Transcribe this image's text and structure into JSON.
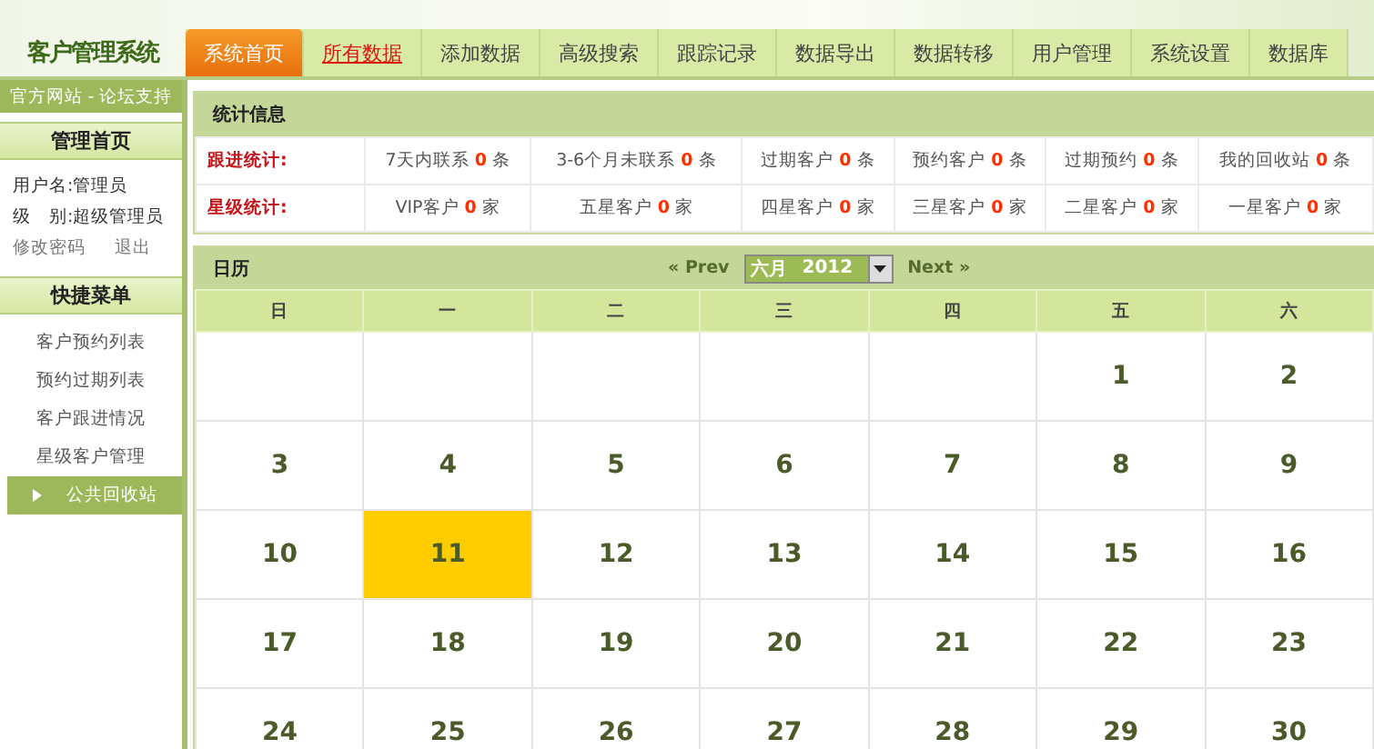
{
  "logo": "客户管理系统",
  "nav": [
    {
      "label": "系统首页",
      "selected": true,
      "kind": "normal"
    },
    {
      "label": "所有数据",
      "selected": false,
      "kind": "highlight"
    },
    {
      "label": "添加数据",
      "selected": false,
      "kind": "normal"
    },
    {
      "label": "高级搜索",
      "selected": false,
      "kind": "normal"
    },
    {
      "label": "跟踪记录",
      "selected": false,
      "kind": "normal"
    },
    {
      "label": "数据导出",
      "selected": false,
      "kind": "normal"
    },
    {
      "label": "数据转移",
      "selected": false,
      "kind": "normal"
    },
    {
      "label": "用户管理",
      "selected": false,
      "kind": "normal"
    },
    {
      "label": "系统设置",
      "selected": false,
      "kind": "normal"
    },
    {
      "label": "数据库",
      "selected": false,
      "kind": "normal"
    }
  ],
  "sidebar": {
    "top_links": "官方网站 - 论坛支持",
    "admin": {
      "title": "管理首页",
      "username": "用户名:管理员",
      "level": "级　别:超级管理员",
      "links": [
        "修改密码",
        "退出"
      ]
    },
    "menu": {
      "title": "快捷菜单",
      "items": [
        {
          "label": "客户预约列表",
          "selected": false
        },
        {
          "label": "预约过期列表",
          "selected": false
        },
        {
          "label": "客户跟进情况",
          "selected": false
        },
        {
          "label": "星级客户管理",
          "selected": false
        },
        {
          "label": "公共回收站",
          "selected": true
        }
      ]
    }
  },
  "stats": {
    "title": "统计信息",
    "rows": [
      {
        "label": "跟进统计:",
        "cells": [
          {
            "text": "7天内联系",
            "count": "0",
            "unit": "条"
          },
          {
            "text": "3-6个月未联系",
            "count": "0",
            "unit": "条"
          },
          {
            "text": "过期客户",
            "count": "0",
            "unit": "条"
          },
          {
            "text": "预约客户",
            "count": "0",
            "unit": "条"
          },
          {
            "text": "过期预约",
            "count": "0",
            "unit": "条"
          },
          {
            "text": "我的回收站",
            "count": "0",
            "unit": "条"
          }
        ]
      },
      {
        "label": "星级统计:",
        "cells": [
          {
            "text": "VIP客户",
            "count": "0",
            "unit": "家"
          },
          {
            "text": "五星客户",
            "count": "0",
            "unit": "家"
          },
          {
            "text": "四星客户",
            "count": "0",
            "unit": "家"
          },
          {
            "text": "三星客户",
            "count": "0",
            "unit": "家"
          },
          {
            "text": "二星客户",
            "count": "0",
            "unit": "家"
          },
          {
            "text": "一星客户",
            "count": "0",
            "unit": "家"
          }
        ]
      }
    ]
  },
  "calendar": {
    "title": "日历",
    "prev": "« Prev",
    "next": "Next »",
    "month": "六月",
    "year": "2012",
    "weekdays": [
      "日",
      "一",
      "二",
      "三",
      "四",
      "五",
      "六"
    ],
    "weeks": [
      [
        {
          "kind": "empty"
        },
        {
          "kind": "empty"
        },
        {
          "kind": "empty"
        },
        {
          "kind": "empty"
        },
        {
          "kind": "empty"
        },
        {
          "kind": "day",
          "day": "1",
          "selected": false
        },
        {
          "kind": "day",
          "day": "2",
          "selected": false
        }
      ],
      [
        {
          "kind": "day",
          "day": "3",
          "selected": false
        },
        {
          "kind": "day",
          "day": "4",
          "selected": false
        },
        {
          "kind": "day",
          "day": "5",
          "selected": false
        },
        {
          "kind": "day",
          "day": "6",
          "selected": false
        },
        {
          "kind": "day",
          "day": "7",
          "selected": false
        },
        {
          "kind": "day",
          "day": "8",
          "selected": false
        },
        {
          "kind": "day",
          "day": "9",
          "selected": false
        }
      ],
      [
        {
          "kind": "day",
          "day": "10",
          "selected": false
        },
        {
          "kind": "day",
          "day": "11",
          "selected": true
        },
        {
          "kind": "day",
          "day": "12",
          "selected": false
        },
        {
          "kind": "day",
          "day": "13",
          "selected": false
        },
        {
          "kind": "day",
          "day": "14",
          "selected": false
        },
        {
          "kind": "day",
          "day": "15",
          "selected": false
        },
        {
          "kind": "day",
          "day": "16",
          "selected": false
        }
      ],
      [
        {
          "kind": "day",
          "day": "17",
          "selected": false
        },
        {
          "kind": "day",
          "day": "18",
          "selected": false
        },
        {
          "kind": "day",
          "day": "19",
          "selected": false
        },
        {
          "kind": "day",
          "day": "20",
          "selected": false
        },
        {
          "kind": "day",
          "day": "21",
          "selected": false
        },
        {
          "kind": "day",
          "day": "22",
          "selected": false
        },
        {
          "kind": "day",
          "day": "23",
          "selected": false
        }
      ],
      [
        {
          "kind": "day",
          "day": "24",
          "selected": false
        },
        {
          "kind": "day",
          "day": "25",
          "selected": false
        },
        {
          "kind": "day",
          "day": "26",
          "selected": false
        },
        {
          "kind": "day",
          "day": "27",
          "selected": false
        },
        {
          "kind": "day",
          "day": "28",
          "selected": false
        },
        {
          "kind": "day",
          "day": "29",
          "selected": false
        },
        {
          "kind": "day",
          "day": "30",
          "selected": false
        }
      ]
    ]
  }
}
